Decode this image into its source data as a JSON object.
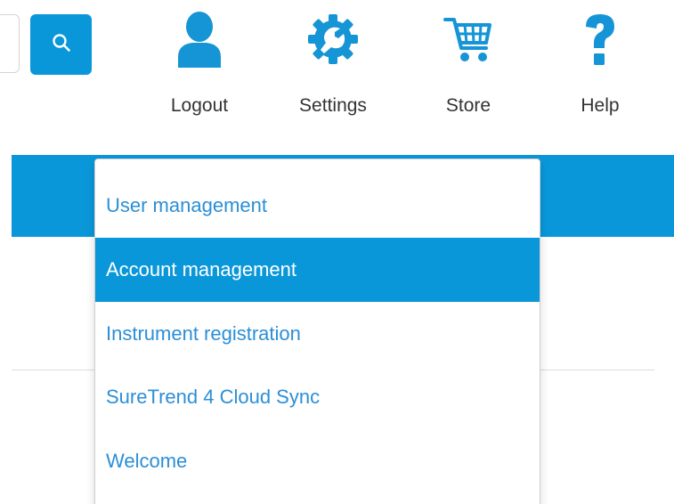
{
  "colors": {
    "accent": "#0a97d9",
    "icon_blue": "#1595d6",
    "link_blue": "#2b8fd6",
    "label_text": "#333333"
  },
  "header": {
    "search": {
      "placeholder": "",
      "button_icon": "search-icon"
    },
    "nav": [
      {
        "label": "Logout",
        "icon": "user-icon"
      },
      {
        "label": "Settings",
        "icon": "gear-wrench-icon"
      },
      {
        "label": "Store",
        "icon": "shopping-cart-icon"
      },
      {
        "label": "Help",
        "icon": "question-mark-icon"
      }
    ]
  },
  "settings_menu": {
    "items": [
      {
        "label": "User management",
        "active": false
      },
      {
        "label": "Account management",
        "active": true
      },
      {
        "label": "Instrument registration",
        "active": false
      },
      {
        "label": "SureTrend 4 Cloud Sync",
        "active": false
      },
      {
        "label": "Welcome",
        "active": false
      }
    ]
  }
}
